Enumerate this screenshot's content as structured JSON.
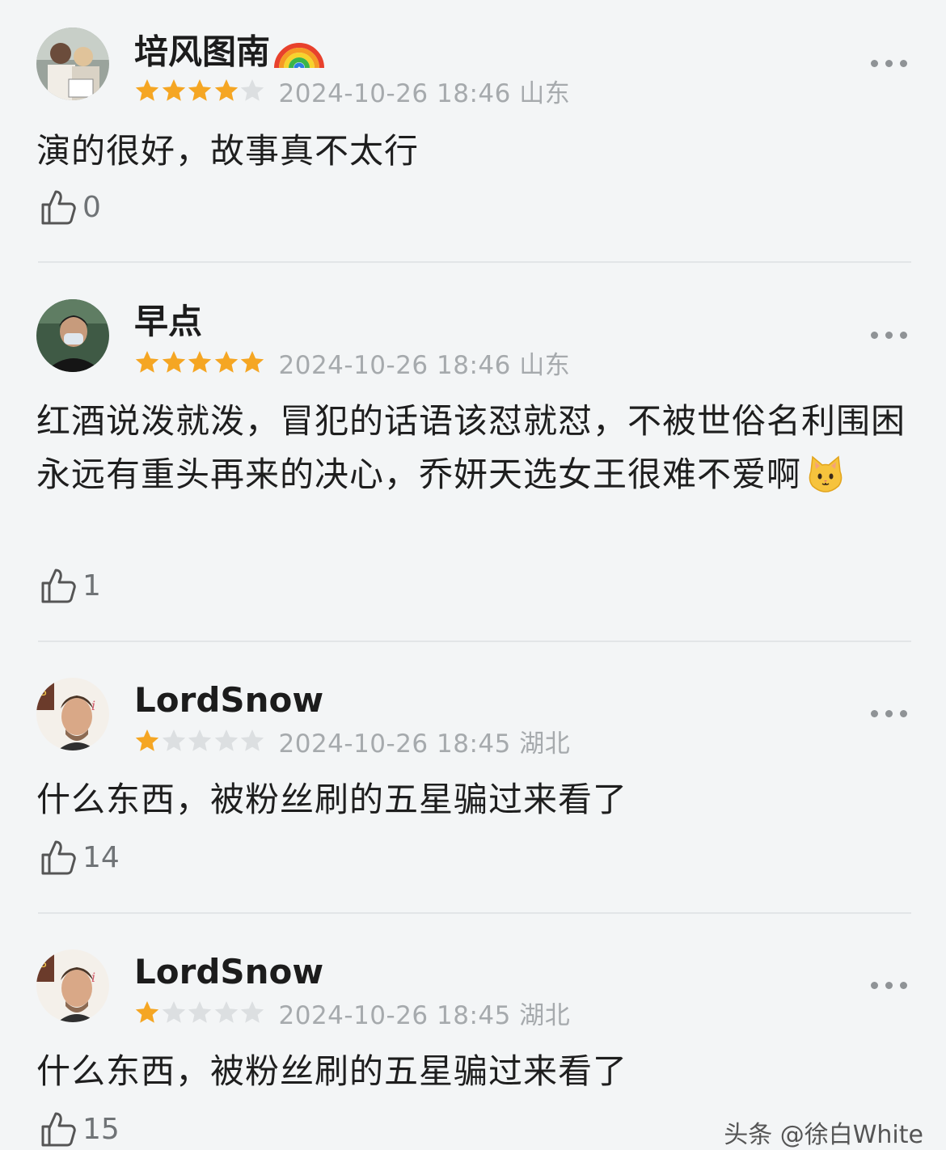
{
  "comments": [
    {
      "username": "培风图南",
      "username_emoji": "rainbow",
      "rating": 4,
      "meta": "2024-10-26 18:46 山东",
      "content": "演的很好，故事真不太行",
      "likes": "0"
    },
    {
      "username": "早点",
      "rating": 5,
      "meta": "2024-10-26 18:46 山东",
      "content": "红酒说泼就泼，冒犯的话语该怼就怼，不被世俗名利围困永远有重头再来的决心，乔妍天选女王很难不爱啊",
      "content_emoji": "cat-face",
      "likes": "1"
    },
    {
      "username": "LordSnow",
      "rating": 1,
      "meta": "2024-10-26 18:45 湖北",
      "content": "什么东西，被粉丝刷的五星骗过来看了",
      "likes": "14"
    },
    {
      "username": "LordSnow",
      "rating": 1,
      "meta": "2024-10-26 18:45 湖北",
      "content": "什么东西，被粉丝刷的五星骗过来看了",
      "likes": "15"
    }
  ],
  "watermark": "头条 @徐白White",
  "colors": {
    "star_filled": "#f5a623",
    "star_empty": "#dcdfe1",
    "meta_text": "#a6aaad",
    "background": "#f3f5f6"
  },
  "icons": {
    "like": "thumbs-up-icon",
    "more": "more-dots-icon"
  }
}
